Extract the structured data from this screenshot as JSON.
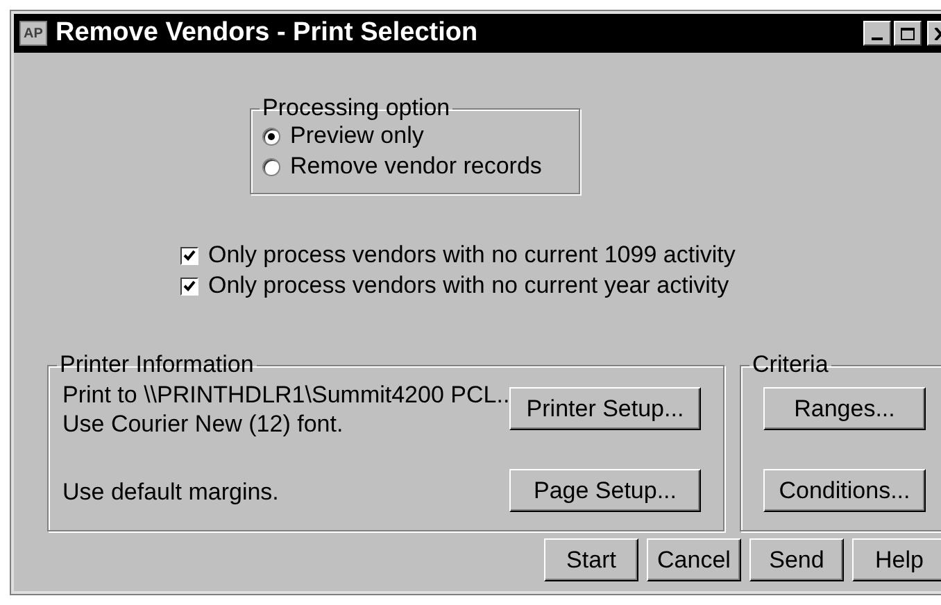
{
  "window": {
    "icon_text": "AP",
    "title": "Remove Vendors - Print Selection"
  },
  "processing_option": {
    "legend": "Processing option",
    "options": [
      {
        "label": "Preview only",
        "selected": true
      },
      {
        "label": "Remove vendor records",
        "selected": false
      }
    ]
  },
  "checkboxes": [
    {
      "label": "Only process vendors with no current 1099 activity",
      "checked": true
    },
    {
      "label": "Only process vendors with no current year activity",
      "checked": true
    }
  ],
  "printer_information": {
    "legend": "Printer Information",
    "print_to": "Print to \\\\PRINTHDLR1\\Summit4200 PCL..",
    "font": "Use Courier New (12) font.",
    "margins": "Use default margins.",
    "buttons": [
      "Printer Setup...",
      "Page Setup..."
    ]
  },
  "criteria": {
    "legend": "Criteria",
    "buttons": [
      "Ranges...",
      "Conditions..."
    ]
  },
  "buttons": [
    "Start",
    "Cancel",
    "Send",
    "Help"
  ]
}
